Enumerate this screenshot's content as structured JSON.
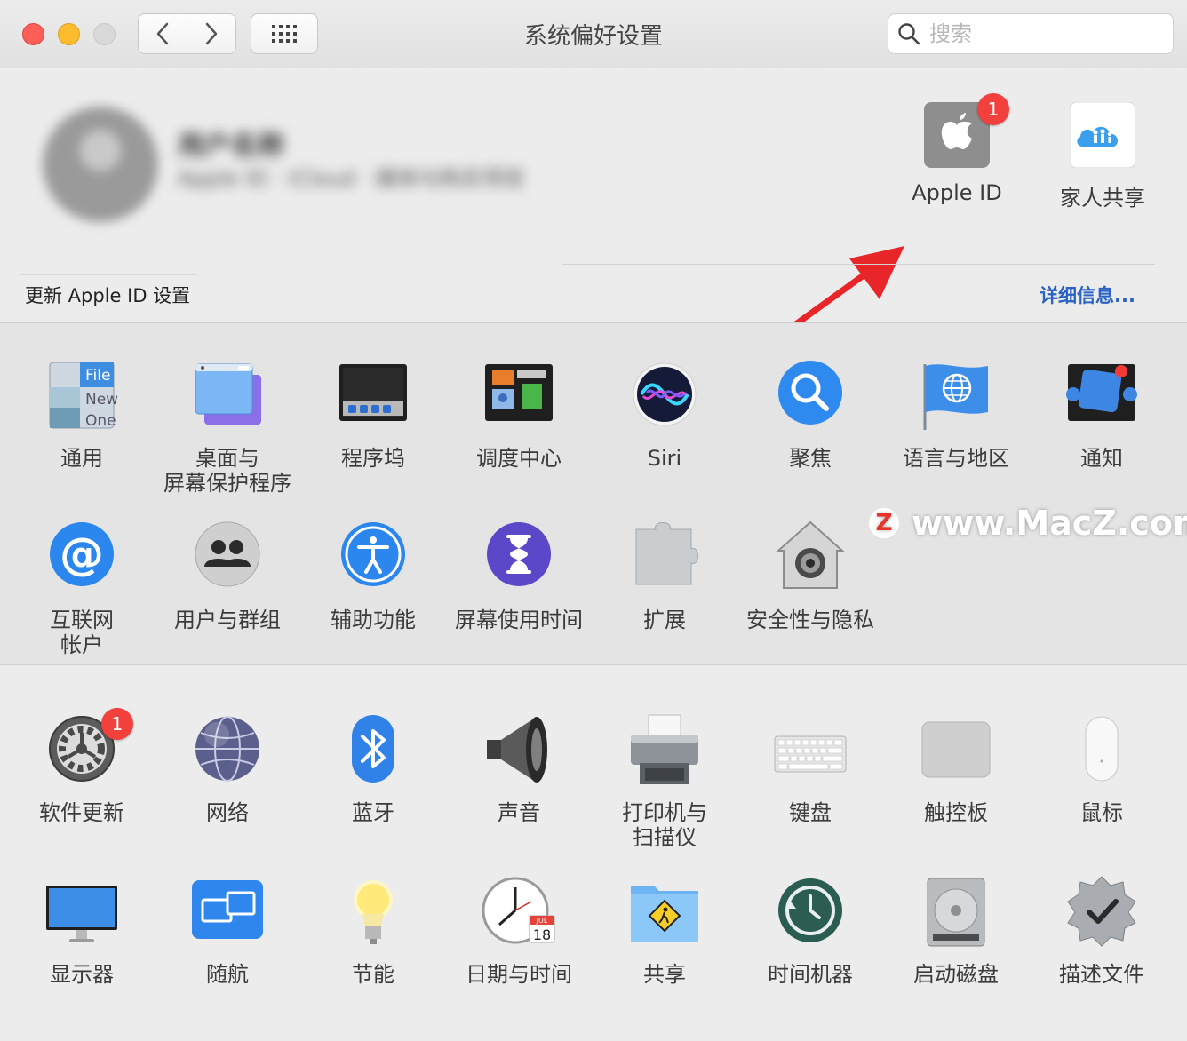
{
  "window": {
    "title": "系统偏好设置"
  },
  "search": {
    "placeholder": "搜索"
  },
  "account": {
    "name_blurred": "用户名称",
    "detail_blurred": "Apple ID · iCloud · 媒体与购买项目",
    "update_text": "更新 Apple ID 设置",
    "details_link": "详细信息...",
    "items": [
      {
        "label": "Apple ID",
        "icon": "apple-id-icon",
        "badge": "1"
      },
      {
        "label": "家人共享",
        "icon": "family-sharing-icon"
      }
    ]
  },
  "section1": {
    "row1": [
      {
        "label": "通用",
        "icon": "general-icon"
      },
      {
        "label": "桌面与\n屏幕保护程序",
        "icon": "desktop-screensaver-icon"
      },
      {
        "label": "程序坞",
        "icon": "dock-icon"
      },
      {
        "label": "调度中心",
        "icon": "mission-control-icon"
      },
      {
        "label": "Siri",
        "icon": "siri-icon"
      },
      {
        "label": "聚焦",
        "icon": "spotlight-icon"
      },
      {
        "label": "语言与地区",
        "icon": "language-region-icon"
      },
      {
        "label": "通知",
        "icon": "notifications-icon"
      }
    ],
    "row2": [
      {
        "label": "互联网\n帐户",
        "icon": "internet-accounts-icon"
      },
      {
        "label": "用户与群组",
        "icon": "users-groups-icon"
      },
      {
        "label": "辅助功能",
        "icon": "accessibility-icon"
      },
      {
        "label": "屏幕使用时间",
        "icon": "screen-time-icon"
      },
      {
        "label": "扩展",
        "icon": "extensions-icon"
      },
      {
        "label": "安全性与隐私",
        "icon": "security-privacy-icon"
      }
    ]
  },
  "section2": {
    "row1": [
      {
        "label": "软件更新",
        "icon": "software-update-icon",
        "badge": "1"
      },
      {
        "label": "网络",
        "icon": "network-icon"
      },
      {
        "label": "蓝牙",
        "icon": "bluetooth-icon"
      },
      {
        "label": "声音",
        "icon": "sound-icon"
      },
      {
        "label": "打印机与\n扫描仪",
        "icon": "printers-scanners-icon"
      },
      {
        "label": "键盘",
        "icon": "keyboard-icon"
      },
      {
        "label": "触控板",
        "icon": "trackpad-icon"
      },
      {
        "label": "鼠标",
        "icon": "mouse-icon"
      }
    ],
    "row2": [
      {
        "label": "显示器",
        "icon": "displays-icon"
      },
      {
        "label": "随航",
        "icon": "sidecar-icon"
      },
      {
        "label": "节能",
        "icon": "energy-saver-icon"
      },
      {
        "label": "日期与时间",
        "icon": "date-time-icon"
      },
      {
        "label": "共享",
        "icon": "sharing-icon"
      },
      {
        "label": "时间机器",
        "icon": "time-machine-icon"
      },
      {
        "label": "启动磁盘",
        "icon": "startup-disk-icon"
      },
      {
        "label": "描述文件",
        "icon": "profiles-icon"
      }
    ]
  },
  "icon_text": {
    "general_file": "File",
    "general_new": "New",
    "general_one": "One",
    "calendar_month": "JUL",
    "calendar_day": "18"
  },
  "watermark": {
    "logo_letter": "Z",
    "text": "www.MacZ.com"
  },
  "colors": {
    "accent": "#2a63c4",
    "badge": "#f2403d",
    "arrow": "#e8262a"
  }
}
